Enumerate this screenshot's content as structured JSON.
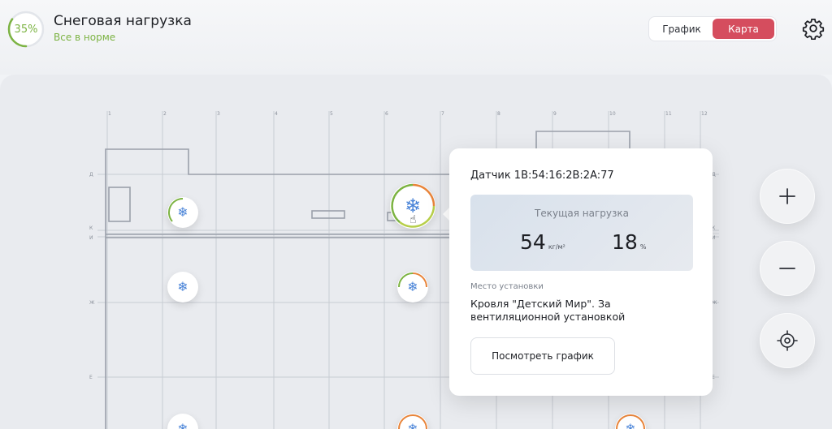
{
  "header": {
    "progress_text": "35%",
    "progress_value": 0.35,
    "title": "Снеговая нагрузка",
    "status": "Все в норме",
    "toggle": {
      "chart_label": "График",
      "map_label": "Карта",
      "active": "map"
    },
    "settings_icon": "gear-icon"
  },
  "map": {
    "column_labels": [
      "1",
      "2",
      "3",
      "4",
      "5",
      "6",
      "7",
      "8",
      "9",
      "10",
      "11",
      "12"
    ],
    "row_labels_left": [
      "Д",
      "К",
      "И",
      "Ж",
      "Е"
    ],
    "row_labels_right": [
      "Д",
      "К",
      "И",
      "Ж",
      "Е"
    ],
    "sensor_icon": "snowflake-icon",
    "cursor_icon": "hand-pointer-icon"
  },
  "popup": {
    "title": "Датчик 1B:54:16:2B:2A:77",
    "current_load_label": "Текущая нагрузка",
    "load_value": "54",
    "load_unit": "кг/м²",
    "percent_value": "18",
    "percent_unit": "%",
    "place_label": "Место установки",
    "place_text": "Кровля \"Детский Мир\". За вентиляционной установкой",
    "button_label": "Посмотреть график"
  },
  "controls": {
    "zoom_in_icon": "plus-icon",
    "zoom_out_icon": "minus-icon",
    "locate_icon": "target-icon"
  },
  "colors": {
    "accent_red": "#d54d5e",
    "ok_green": "#7cb342",
    "warn_orange": "#e8843a",
    "snow_blue": "#4a84d8"
  }
}
